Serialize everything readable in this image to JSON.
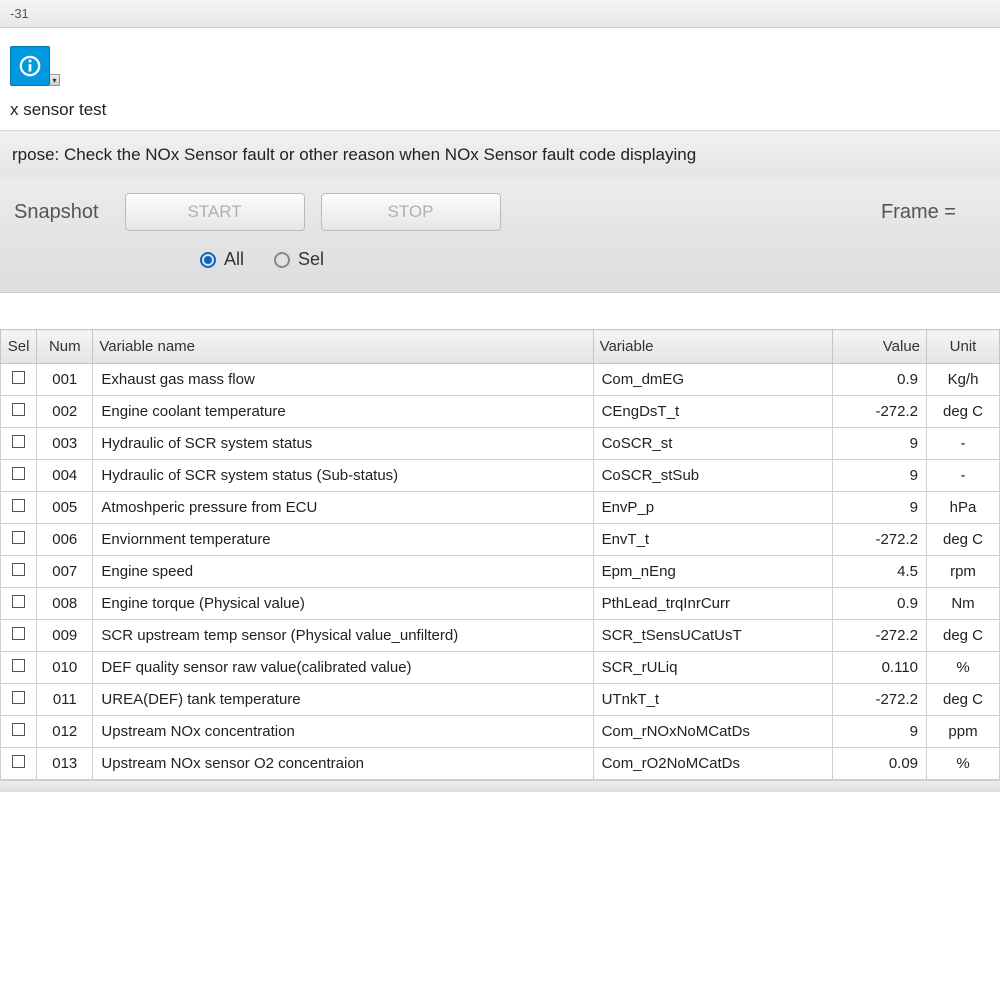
{
  "titlebar": "-31",
  "page_title": "x sensor test",
  "purpose_prefix": "rpose: ",
  "purpose": "Check the NOx Sensor fault or other reason when NOx Sensor fault code displaying",
  "snapshot_label": "Snapshot",
  "start_btn": "START",
  "stop_btn": "STOP",
  "frame_label": "Frame =",
  "radio_all": "All",
  "radio_sel": "Sel",
  "headers": {
    "sel": "Sel",
    "num": "Num",
    "name": "Variable name",
    "var": "Variable",
    "val": "Value",
    "unit": "Unit"
  },
  "rows": [
    {
      "num": "001",
      "name": "Exhaust gas mass flow",
      "var": "Com_dmEG",
      "val": "0.9",
      "unit": "Kg/h"
    },
    {
      "num": "002",
      "name": "Engine coolant temperature",
      "var": "CEngDsT_t",
      "val": "-272.2",
      "unit": "deg C"
    },
    {
      "num": "003",
      "name": "Hydraulic of SCR system status",
      "var": "CoSCR_st",
      "val": "9",
      "unit": "-"
    },
    {
      "num": "004",
      "name": "Hydraulic of SCR system status (Sub-status)",
      "var": "CoSCR_stSub",
      "val": "9",
      "unit": "-"
    },
    {
      "num": "005",
      "name": "Atmoshperic pressure from ECU",
      "var": "EnvP_p",
      "val": "9",
      "unit": "hPa"
    },
    {
      "num": "006",
      "name": "Enviornment temperature",
      "var": "EnvT_t",
      "val": "-272.2",
      "unit": "deg C"
    },
    {
      "num": "007",
      "name": "Engine speed",
      "var": "Epm_nEng",
      "val": "4.5",
      "unit": "rpm"
    },
    {
      "num": "008",
      "name": "Engine torque (Physical value)",
      "var": "PthLead_trqInrCurr",
      "val": "0.9",
      "unit": "Nm"
    },
    {
      "num": "009",
      "name": "SCR upstream temp sensor (Physical value_unfilterd)",
      "var": "SCR_tSensUCatUsT",
      "val": "-272.2",
      "unit": "deg C"
    },
    {
      "num": "010",
      "name": "DEF quality sensor raw value(calibrated value)",
      "var": "SCR_rULiq",
      "val": "0.110",
      "unit": "%"
    },
    {
      "num": "011",
      "name": "UREA(DEF) tank temperature",
      "var": "UTnkT_t",
      "val": "-272.2",
      "unit": "deg C"
    },
    {
      "num": "012",
      "name": "Upstream NOx concentration",
      "var": "Com_rNOxNoMCatDs",
      "val": "9",
      "unit": "ppm"
    },
    {
      "num": "013",
      "name": "Upstream NOx sensor O2 concentraion",
      "var": "Com_rO2NoMCatDs",
      "val": "0.09",
      "unit": "%"
    }
  ]
}
